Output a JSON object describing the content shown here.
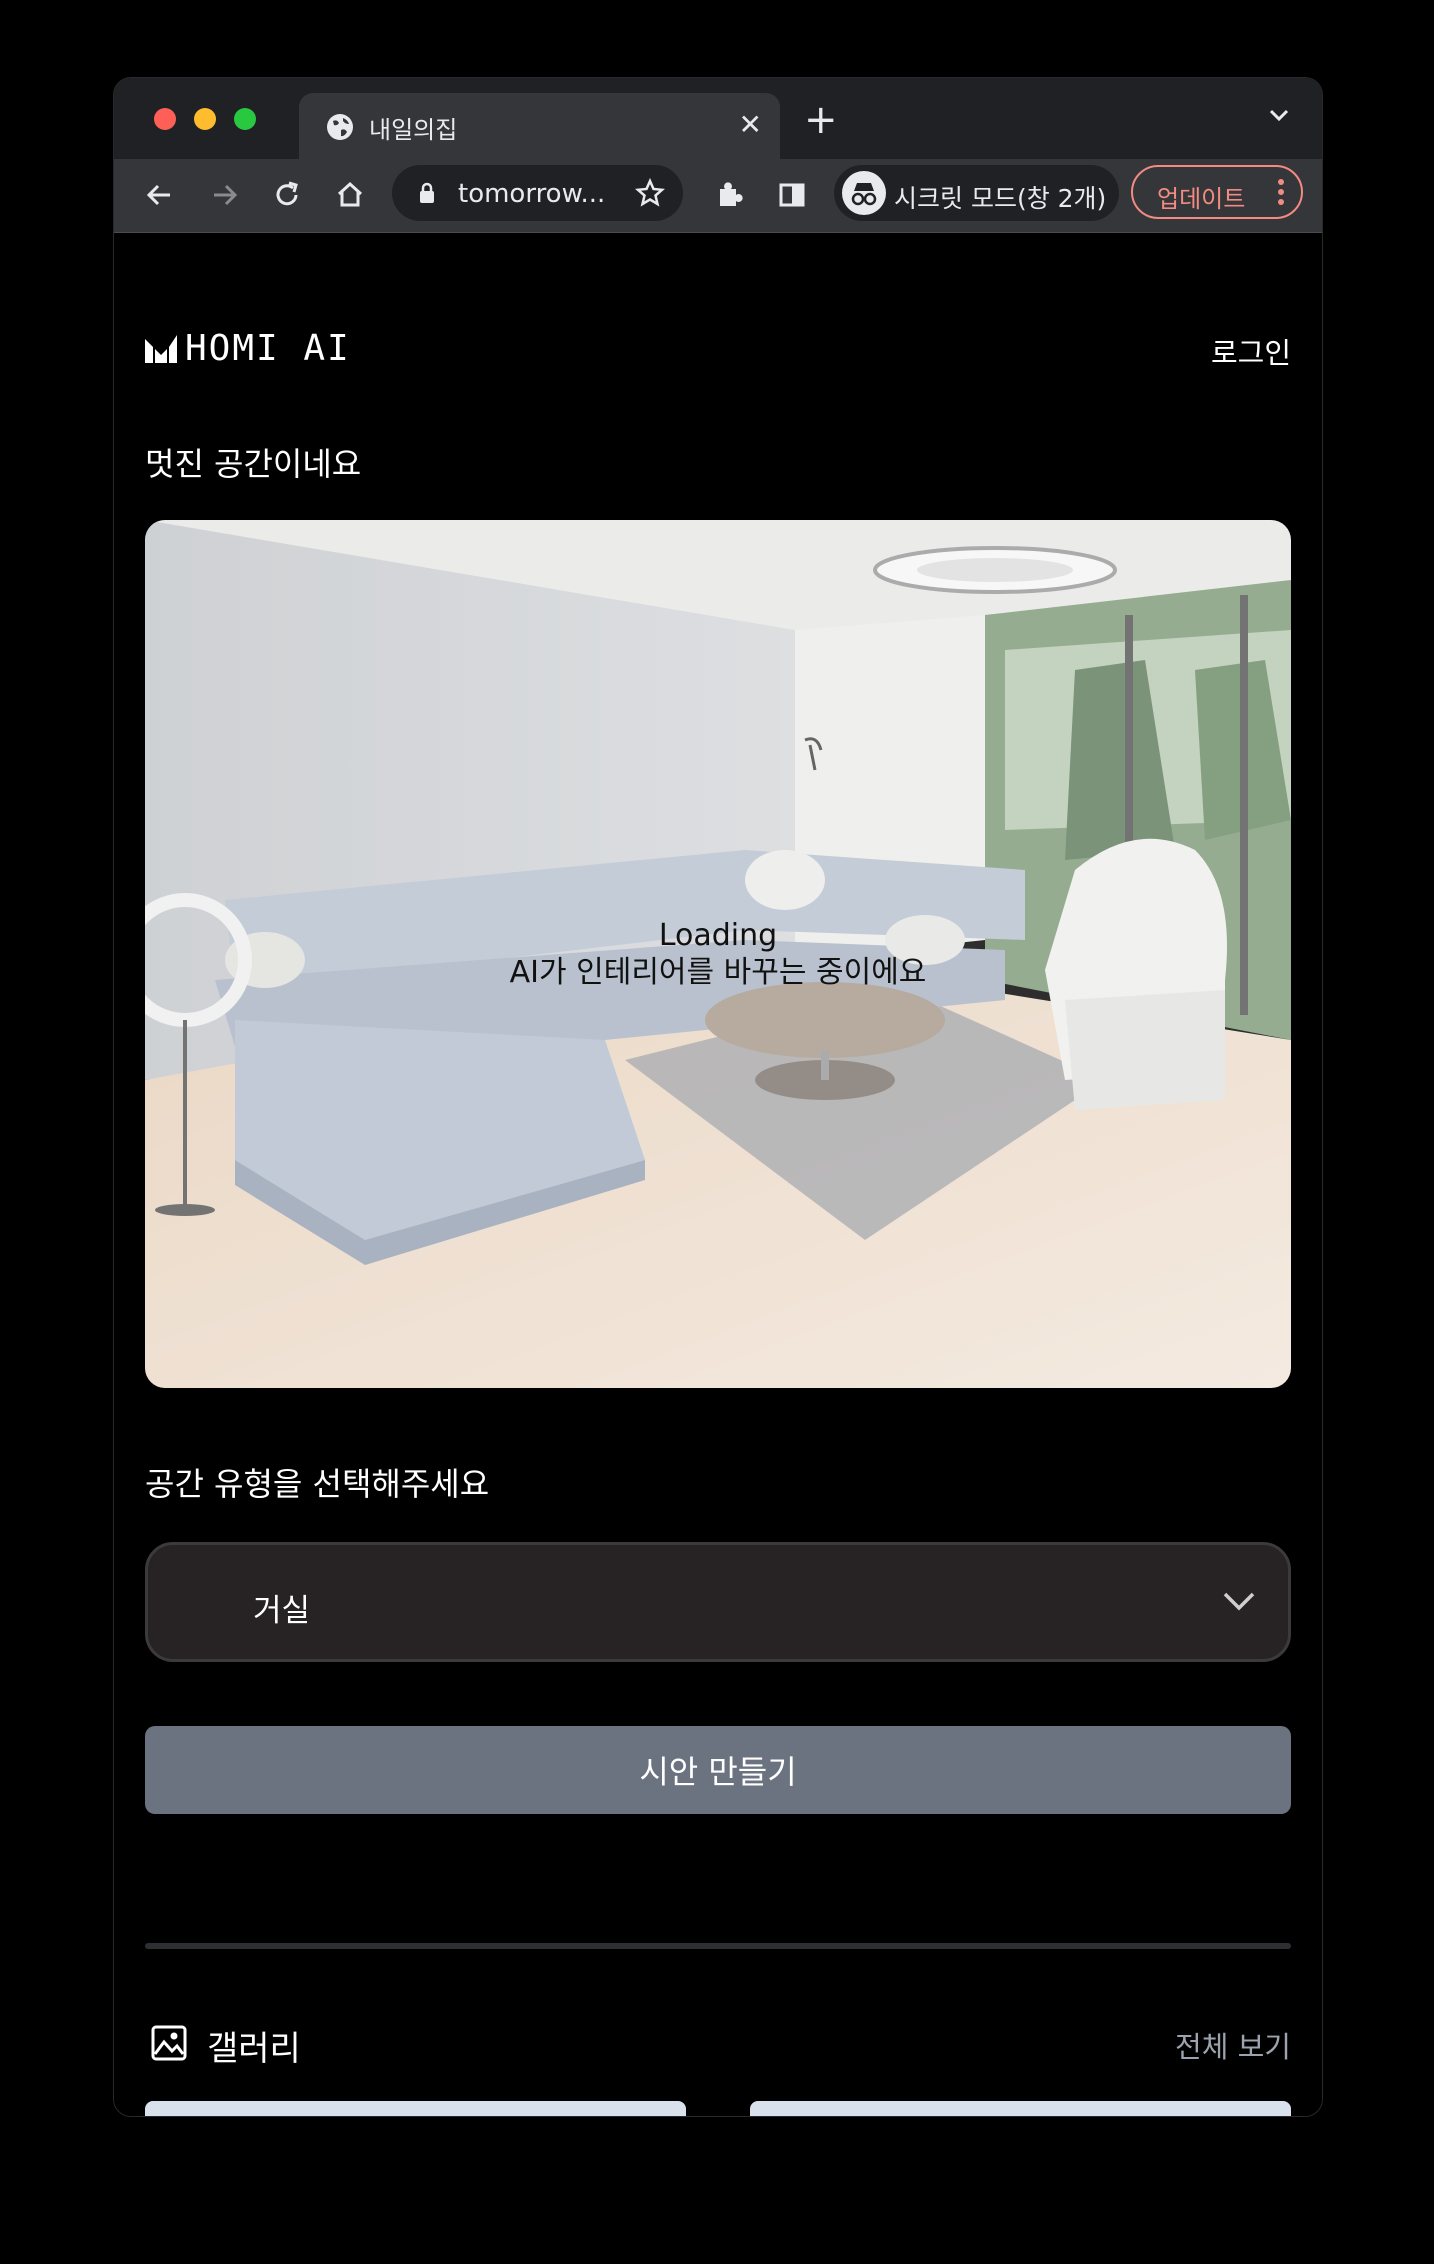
{
  "browser": {
    "tab_title": "내일의집",
    "url": "tomorrow...",
    "incognito_label": "시크릿 모드(창 2개)",
    "update_label": "업데이트"
  },
  "header": {
    "logo_text": "HOMI AI",
    "login_label": "로그인"
  },
  "main": {
    "greeting": "멋진 공간이네요",
    "preview": {
      "loading_title": "Loading",
      "loading_message": "AI가 인테리어를 바꾸는 중이에요"
    },
    "space_type_label": "공간 유형을 선택해주세요",
    "space_type_selected": "거실",
    "create_button_label": "시안 만들기"
  },
  "gallery": {
    "title": "갤러리",
    "view_all_label": "전체 보기"
  },
  "colors": {
    "button_bg": "#6b7280",
    "select_bg": "#272324",
    "update_accent": "#f28b82"
  }
}
